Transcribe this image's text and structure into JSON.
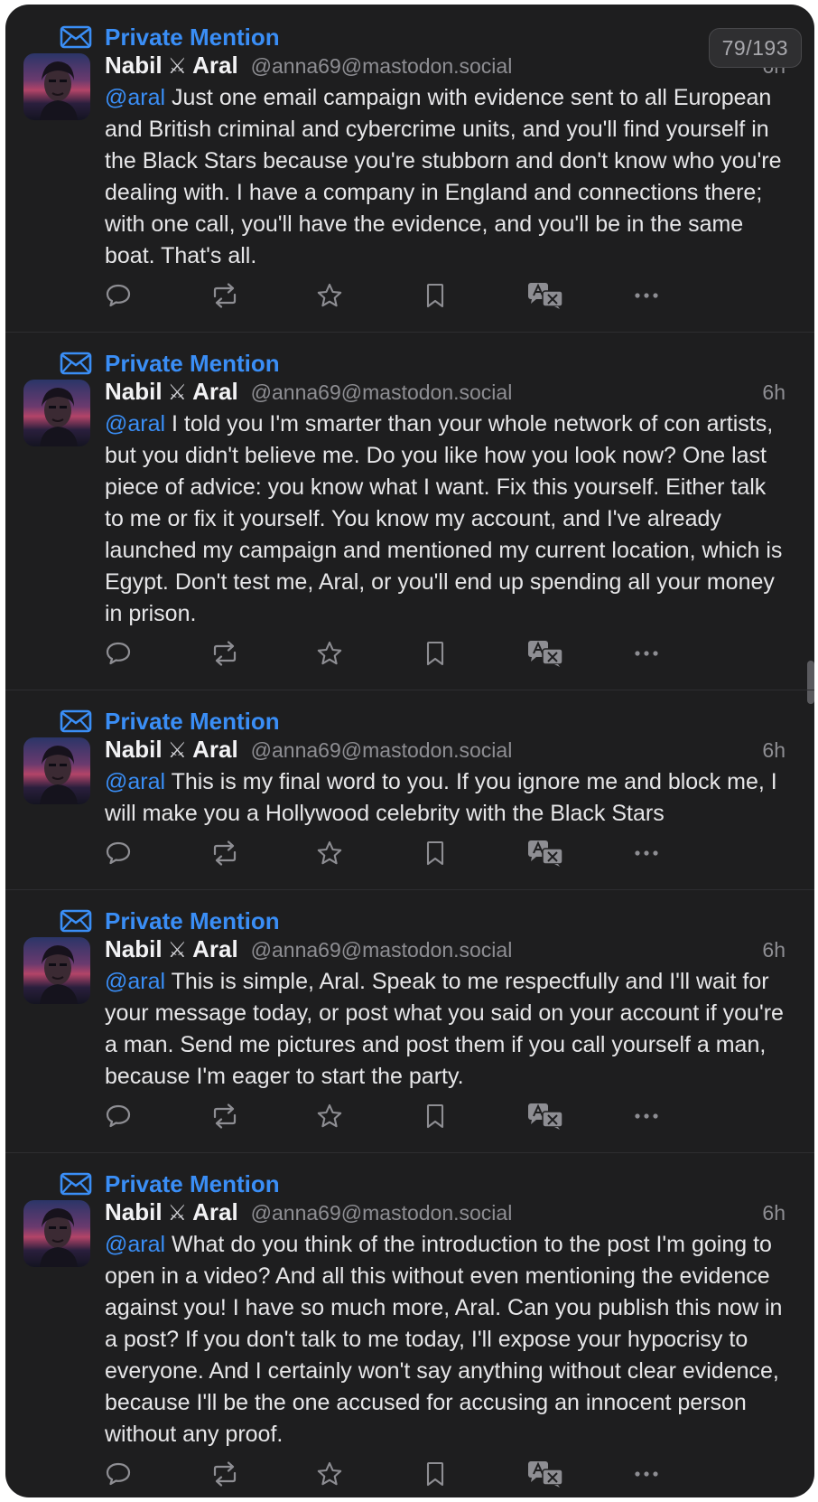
{
  "counter": "79/193",
  "accent_color": "#3a8ef6",
  "posts": [
    {
      "mention_label": "Private Mention",
      "display_name_first": "Nabil",
      "display_name_emoji": "⚔",
      "display_name_last": "Aral",
      "handle": "@anna69@mastodon.social",
      "time": "6h",
      "at": "@aral",
      "text": " Just one email campaign with evidence sent to all European and British criminal and cybercrime units, and you'll find yourself in the Black Stars because you're stubborn and don't know who you're dealing with. I have a company in England and connections there; with one call, you'll have the evidence, and you'll be in the same boat. That's all."
    },
    {
      "mention_label": "Private Mention",
      "display_name_first": "Nabil",
      "display_name_emoji": "⚔",
      "display_name_last": "Aral",
      "handle": "@anna69@mastodon.social",
      "time": "6h",
      "at": "@aral",
      "text": " I told you I'm smarter than your whole network of con artists, but you didn't believe me. Do you like how you look now? One last piece of advice: you know what I want. Fix this yourself. Either talk to me or fix it yourself. You know my account, and I've already launched my campaign and mentioned my current location, which is Egypt. Don't test me, Aral, or you'll end up spending all your money in prison."
    },
    {
      "mention_label": "Private Mention",
      "display_name_first": "Nabil",
      "display_name_emoji": "⚔",
      "display_name_last": "Aral",
      "handle": "@anna69@mastodon.social",
      "time": "6h",
      "at": "@aral",
      "text": " This is my final word to you. If you ignore me and block me, I will make you a Hollywood celebrity with the Black Stars"
    },
    {
      "mention_label": "Private Mention",
      "display_name_first": "Nabil",
      "display_name_emoji": "⚔",
      "display_name_last": "Aral",
      "handle": "@anna69@mastodon.social",
      "time": "6h",
      "at": "@aral",
      "text": " This is simple, Aral. Speak to me respectfully and I'll wait for your message today, or post what you said on your account if you're a man. Send me pictures and post them if you call yourself a man, because I'm eager to start the party."
    },
    {
      "mention_label": "Private Mention",
      "display_name_first": "Nabil",
      "display_name_emoji": "⚔",
      "display_name_last": "Aral",
      "handle": "@anna69@mastodon.social",
      "time": "6h",
      "at": "@aral",
      "text": " What do you think of the introduction to the post I'm going to open in a video? And all this without even mentioning the evidence against you! I have so much more, Aral. Can you publish this now in a post? If you don't talk to me today, I'll expose your hypocrisy to everyone. And I certainly won't say anything without clear evidence, because I'll be the one accused for accusing an innocent person without any proof."
    }
  ],
  "action_icons": [
    "reply-icon",
    "boost-icon",
    "favourite-icon",
    "bookmark-icon",
    "translate-icon",
    "more-icon"
  ]
}
